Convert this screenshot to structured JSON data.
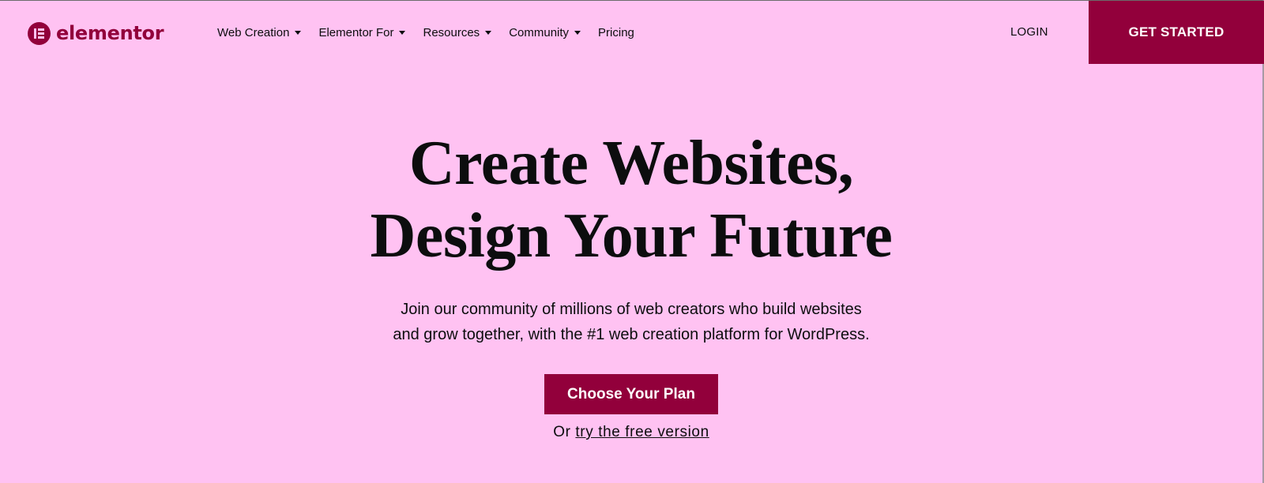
{
  "brand": {
    "name": "elementor",
    "logo_icon": "elementor-e-icon",
    "color": "#92003b",
    "background": "#ffc2f2"
  },
  "nav": {
    "items": [
      {
        "label": "Web Creation",
        "has_dropdown": true
      },
      {
        "label": "Elementor For",
        "has_dropdown": true
      },
      {
        "label": "Resources",
        "has_dropdown": true
      },
      {
        "label": "Community",
        "has_dropdown": true
      },
      {
        "label": "Pricing",
        "has_dropdown": false
      }
    ],
    "login_label": "LOGIN",
    "get_started_label": "GET STARTED"
  },
  "hero": {
    "title_line1": "Create Websites,",
    "title_line2": "Design Your Future",
    "subtitle_line1": "Join our community of millions of web creators who build websites",
    "subtitle_line2": "and grow together, with the #1 web creation platform for WordPress.",
    "cta_label": "Choose Your Plan",
    "alt_prefix": "Or",
    "alt_link": "try the free version"
  }
}
